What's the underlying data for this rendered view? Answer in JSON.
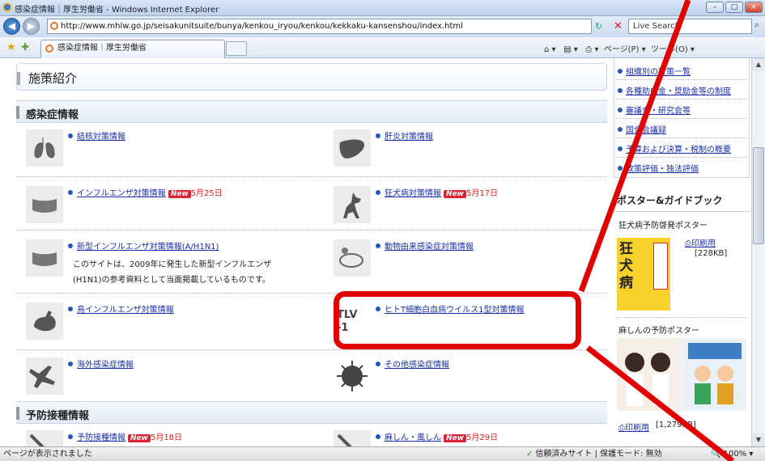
{
  "window": {
    "title": "感染症情報｜厚生労働省 - Windows Internet Explorer"
  },
  "address_bar": {
    "url": "http://www.mhlw.go.jp/seisakunitsuite/bunya/kenkou_iryou/kenkou/kekkaku-kansenshou/index.html",
    "search_placeholder": "Live Search"
  },
  "tab": {
    "label": "感染症情報｜厚生労働省"
  },
  "toolbar": {
    "page_label": "ページ(P)",
    "tools_label": "ツール(O)"
  },
  "main": {
    "page_heading": "施策紹介",
    "section1_title": "感染症情報",
    "items": [
      {
        "icon": "lungs-icon",
        "label": "結核対策情報",
        "badge": "",
        "date": ""
      },
      {
        "icon": "liver-icon",
        "label": "肝炎対策情報",
        "badge": "",
        "date": ""
      },
      {
        "icon": "mask-icon",
        "label": "インフルエンザ対策情報",
        "badge": "New",
        "date": "5月25日"
      },
      {
        "icon": "dog-icon",
        "label": "狂犬病対策情報",
        "badge": "New",
        "date": "5月17日"
      },
      {
        "icon": "mask-icon",
        "label": "新型インフルエンザ対策情報(A/H1N1)",
        "badge": "",
        "date": "",
        "desc": "このサイトは、2009年に発生した新型インフルエンザ(H1N1)の参考資料として当面掲載しているものです。"
      },
      {
        "icon": "animal-icon",
        "label": "動物由来感染症対策情報",
        "badge": "",
        "date": ""
      },
      {
        "icon": "chicken-icon",
        "label": "鳥インフルエンザ対策情報",
        "badge": "",
        "date": ""
      },
      {
        "icon": "tlv-icon",
        "label": "ヒトT細胞白血病ウイルス1型対策情報",
        "badge": "",
        "date": "",
        "icon_text": "TLV -1"
      },
      {
        "icon": "airplane-icon",
        "label": "海外感染症情報",
        "badge": "",
        "date": ""
      },
      {
        "icon": "virus-icon",
        "label": "その他感染症情報",
        "badge": "",
        "date": ""
      }
    ],
    "section2_title": "予防接種情報",
    "items2": [
      {
        "icon": "syringe-icon",
        "label": "予防接種情報",
        "badge": "New",
        "date": "5月18日"
      },
      {
        "icon": "syringe-icon",
        "label": "麻しん・風しん",
        "badge": "New",
        "date": "5月29日"
      }
    ]
  },
  "sidebar": {
    "links": [
      "組織別の政策一覧",
      "各種助成金・奨励金等の制度",
      "審議会・研究会等",
      "国会会議録",
      "予算および決算・税制の概要",
      "政策評価・独法評価"
    ],
    "poster_title": "ポスター&ガイドブック",
    "poster1_caption": "狂犬病予防啓発ポスター",
    "poster1_link": "印刷用",
    "poster1_size": "[228KB]",
    "poster1_text": "狂犬病",
    "poster2_caption": "麻しんの予防ポスター",
    "poster2_link": "印刷用",
    "poster2_size": "[1,279KB]"
  },
  "status": {
    "left": "ページが表示されました",
    "middle": "信頼済みサイト | 保護モード: 無効",
    "zoom": "100%"
  },
  "colors": {
    "annotation": "#e10000",
    "link": "#1a2fa8",
    "new_badge": "#dd2233"
  }
}
